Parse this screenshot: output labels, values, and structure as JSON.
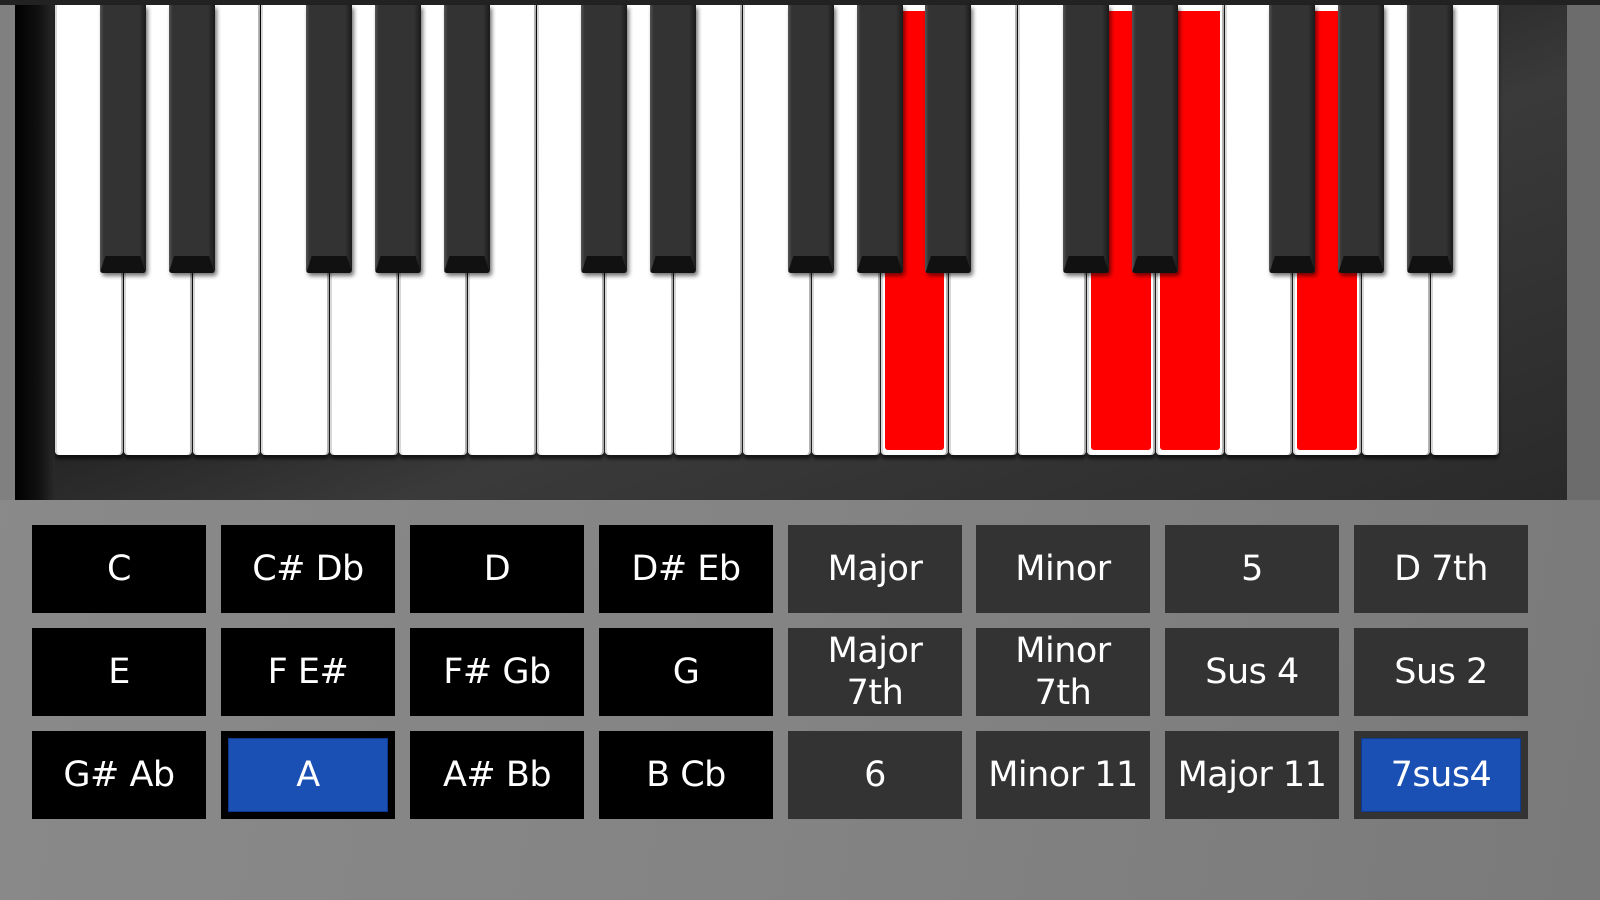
{
  "colors": {
    "active_key": "#ff0000",
    "selected_button": "#1a4fb4",
    "note_button": "#000000",
    "chord_button": "#333333",
    "background": "#858585"
  },
  "keyboard": {
    "white_keys": [
      {
        "note": "C",
        "active": false
      },
      {
        "note": "D",
        "active": false
      },
      {
        "note": "E",
        "active": false
      },
      {
        "note": "F",
        "active": false
      },
      {
        "note": "G",
        "active": false
      },
      {
        "note": "A",
        "active": false
      },
      {
        "note": "B",
        "active": false
      },
      {
        "note": "C",
        "active": false
      },
      {
        "note": "D",
        "active": false
      },
      {
        "note": "E",
        "active": false
      },
      {
        "note": "F",
        "active": false
      },
      {
        "note": "G",
        "active": false
      },
      {
        "note": "A",
        "active": true
      },
      {
        "note": "B",
        "active": false
      },
      {
        "note": "C",
        "active": false
      },
      {
        "note": "D",
        "active": true
      },
      {
        "note": "E",
        "active": true
      },
      {
        "note": "F",
        "active": false
      },
      {
        "note": "G",
        "active": true
      },
      {
        "note": "A",
        "active": false
      },
      {
        "note": "B",
        "active": false
      }
    ],
    "black_keys": [
      {
        "note": "C#",
        "after_white": 0,
        "active": false
      },
      {
        "note": "D#",
        "after_white": 1,
        "active": false
      },
      {
        "note": "F#",
        "after_white": 3,
        "active": false
      },
      {
        "note": "G#",
        "after_white": 4,
        "active": false
      },
      {
        "note": "A#",
        "after_white": 5,
        "active": false
      },
      {
        "note": "C#",
        "after_white": 7,
        "active": false
      },
      {
        "note": "D#",
        "after_white": 8,
        "active": false
      },
      {
        "note": "F#",
        "after_white": 10,
        "active": false
      },
      {
        "note": "G#",
        "after_white": 11,
        "active": false
      },
      {
        "note": "A#",
        "after_white": 12,
        "active": false
      },
      {
        "note": "C#",
        "after_white": 14,
        "active": false
      },
      {
        "note": "D#",
        "after_white": 15,
        "active": false
      },
      {
        "note": "F#",
        "after_white": 17,
        "active": false
      },
      {
        "note": "G#",
        "after_white": 18,
        "active": false
      },
      {
        "note": "A#",
        "after_white": 19,
        "active": false
      }
    ]
  },
  "root_notes": [
    {
      "label": "C",
      "selected": false
    },
    {
      "label": "C# Db",
      "selected": false
    },
    {
      "label": "D",
      "selected": false
    },
    {
      "label": "D# Eb",
      "selected": false
    },
    {
      "label": "E",
      "selected": false
    },
    {
      "label": "F E#",
      "selected": false
    },
    {
      "label": "F# Gb",
      "selected": false
    },
    {
      "label": "G",
      "selected": false
    },
    {
      "label": "G# Ab",
      "selected": false
    },
    {
      "label": "A",
      "selected": true
    },
    {
      "label": "A# Bb",
      "selected": false
    },
    {
      "label": "B Cb",
      "selected": false
    }
  ],
  "chord_types": [
    {
      "label": "Major",
      "selected": false
    },
    {
      "label": "Minor",
      "selected": false
    },
    {
      "label": "5",
      "selected": false
    },
    {
      "label": "D 7th",
      "selected": false
    },
    {
      "label": "Major\n7th",
      "selected": false
    },
    {
      "label": "Minor\n7th",
      "selected": false
    },
    {
      "label": "Sus 4",
      "selected": false
    },
    {
      "label": "Sus 2",
      "selected": false
    },
    {
      "label": "6",
      "selected": false
    },
    {
      "label": "Minor 11",
      "selected": false
    },
    {
      "label": "Major 11",
      "selected": false
    },
    {
      "label": "7sus4",
      "selected": true
    }
  ]
}
